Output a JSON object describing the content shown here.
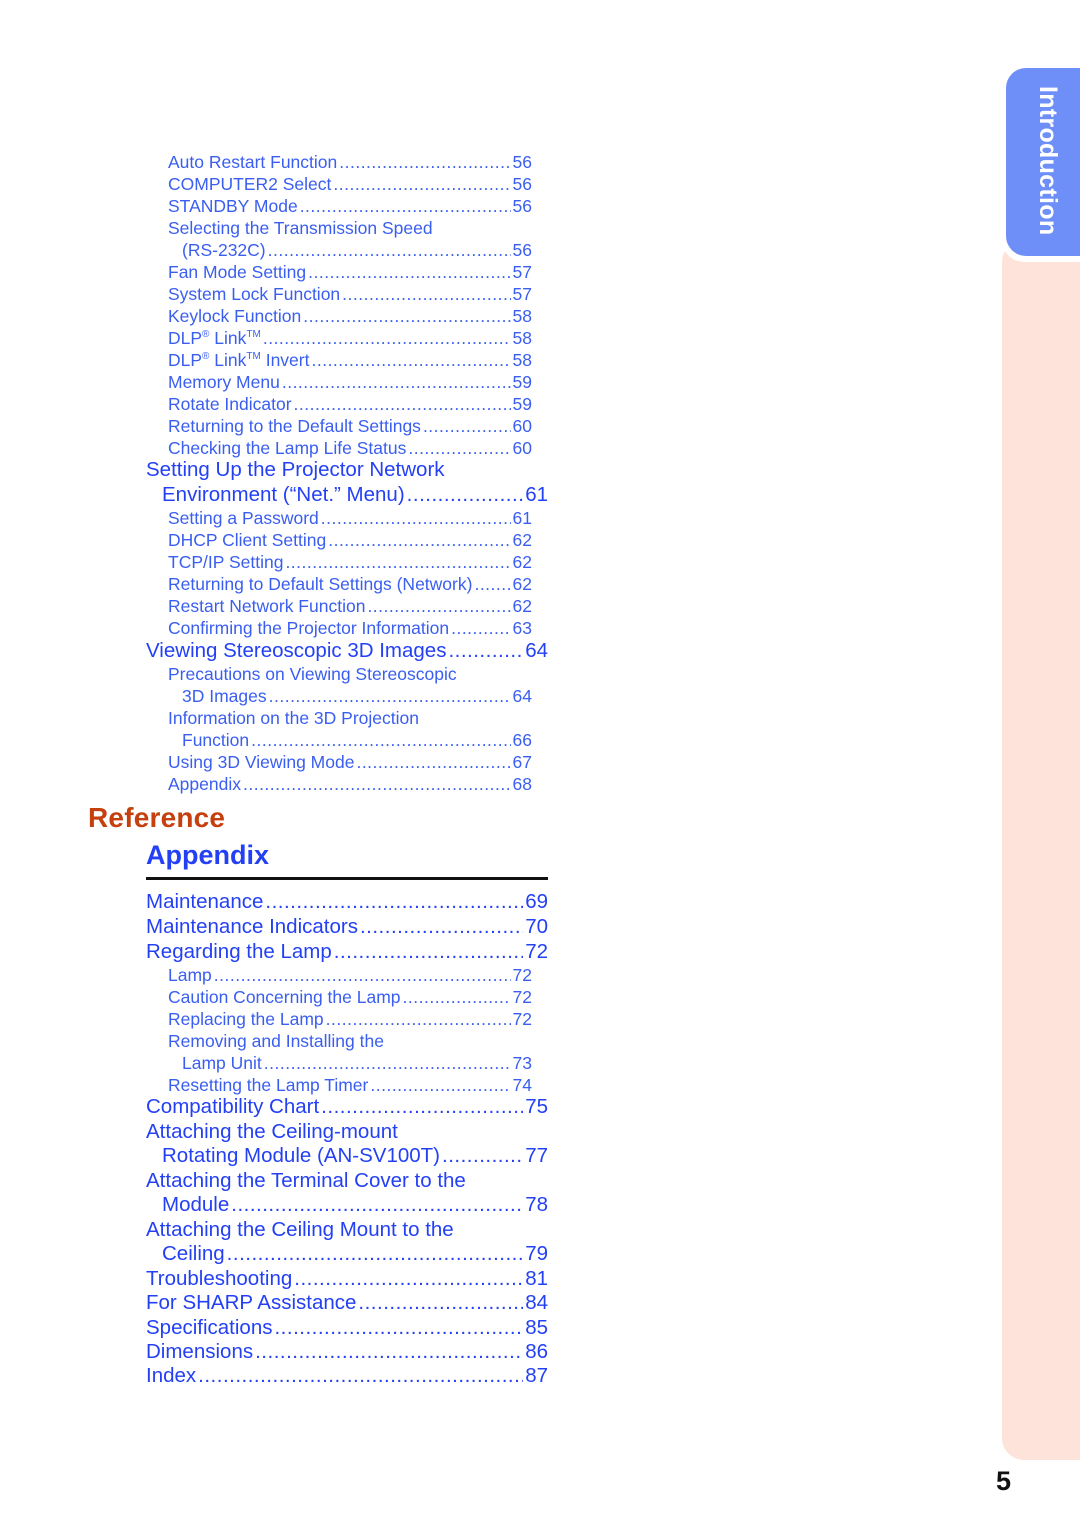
{
  "side_tab": {
    "label": "Introduction",
    "colors": {
      "tab": "#6e8ff7",
      "strip": "#fde3da"
    }
  },
  "toc_top": [
    {
      "level": "sub",
      "title": "Auto Restart Function",
      "page": "56"
    },
    {
      "level": "sub",
      "title": "COMPUTER2 Select",
      "page": "56"
    },
    {
      "level": "sub",
      "title": "STANDBY Mode",
      "page": "56"
    },
    {
      "level": "sub",
      "title": "Selecting the Transmission Speed",
      "page": ""
    },
    {
      "level": "sub-cont",
      "title": "(RS-232C)",
      "page": "56"
    },
    {
      "level": "sub",
      "title": "Fan Mode Setting",
      "page": "57"
    },
    {
      "level": "sub",
      "title": "System Lock Function",
      "page": "57"
    },
    {
      "level": "sub",
      "title": "Keylock Function",
      "page": "58"
    },
    {
      "level": "sub",
      "title": "DLP® Link™",
      "page": "58"
    },
    {
      "level": "sub",
      "title": "DLP® Link™ Invert",
      "page": "58"
    },
    {
      "level": "sub",
      "title": "Memory Menu",
      "page": "59"
    },
    {
      "level": "sub",
      "title": "Rotate Indicator",
      "page": "59"
    },
    {
      "level": "sub",
      "title": "Returning to the Default Settings",
      "page": "60"
    },
    {
      "level": "sub",
      "title": "Checking the Lamp Life Status",
      "page": "60"
    },
    {
      "level": "main",
      "title": "Setting Up the Projector Network",
      "page": ""
    },
    {
      "level": "main-cont",
      "title": "Environment (“Net.” Menu)",
      "page": "61"
    },
    {
      "level": "sub",
      "title": "Setting a Password",
      "page": "61"
    },
    {
      "level": "sub",
      "title": "DHCP Client Setting",
      "page": "62"
    },
    {
      "level": "sub",
      "title": "TCP/IP Setting",
      "page": "62"
    },
    {
      "level": "sub",
      "title": "Returning to Default Settings (Network)",
      "page": "62"
    },
    {
      "level": "sub",
      "title": "Restart Network Function",
      "page": "62"
    },
    {
      "level": "sub",
      "title": "Confirming the Projector Information",
      "page": "63"
    },
    {
      "level": "main",
      "title": "Viewing Stereoscopic 3D Images",
      "page": "64"
    },
    {
      "level": "sub",
      "title": "Precautions on Viewing Stereoscopic",
      "page": ""
    },
    {
      "level": "sub-cont",
      "title": "3D Images",
      "page": "64"
    },
    {
      "level": "sub",
      "title": "Information on the 3D Projection",
      "page": ""
    },
    {
      "level": "sub-cont",
      "title": "Function",
      "page": "66"
    },
    {
      "level": "sub",
      "title": "Using 3D Viewing Mode",
      "page": "67"
    },
    {
      "level": "sub",
      "title": "Appendix",
      "page": "68"
    }
  ],
  "reference": {
    "title": "Reference",
    "color": "#c63f0e"
  },
  "appendix": {
    "title": "Appendix",
    "color": "#2340f5"
  },
  "toc_appendix": [
    {
      "level": "main",
      "title": "Maintenance",
      "page": "69"
    },
    {
      "level": "main",
      "title": "Maintenance Indicators",
      "page": "70"
    },
    {
      "level": "main",
      "title": "Regarding the Lamp",
      "page": "72"
    },
    {
      "level": "sub",
      "title": "Lamp",
      "page": "72"
    },
    {
      "level": "sub",
      "title": "Caution Concerning the Lamp",
      "page": "72"
    },
    {
      "level": "sub",
      "title": "Replacing the Lamp",
      "page": "72"
    },
    {
      "level": "sub",
      "title": "Removing and Installing the",
      "page": ""
    },
    {
      "level": "sub-cont",
      "title": "Lamp Unit",
      "page": "73"
    },
    {
      "level": "sub",
      "title": "Resetting the Lamp Timer",
      "page": "74"
    },
    {
      "level": "main",
      "title": "Compatibility Chart",
      "page": "75"
    },
    {
      "level": "main",
      "title": "Attaching the Ceiling-mount",
      "page": ""
    },
    {
      "level": "main-cont",
      "title": "Rotating Module (AN-SV100T)",
      "page": "77"
    },
    {
      "level": "main",
      "title": "Attaching the Terminal Cover to the",
      "page": ""
    },
    {
      "level": "main-cont",
      "title": "Module",
      "page": "78"
    },
    {
      "level": "main",
      "title": "Attaching the Ceiling Mount to the",
      "page": ""
    },
    {
      "level": "main-cont",
      "title": "Ceiling",
      "page": "79"
    },
    {
      "level": "main",
      "title": "Troubleshooting",
      "page": "81"
    },
    {
      "level": "main",
      "title": "For SHARP Assistance",
      "page": "84"
    },
    {
      "level": "main",
      "title": "Specifications",
      "page": "85"
    },
    {
      "level": "main",
      "title": "Dimensions",
      "page": "86"
    },
    {
      "level": "main",
      "title": "Index",
      "page": "87"
    }
  ],
  "page_number": "5"
}
